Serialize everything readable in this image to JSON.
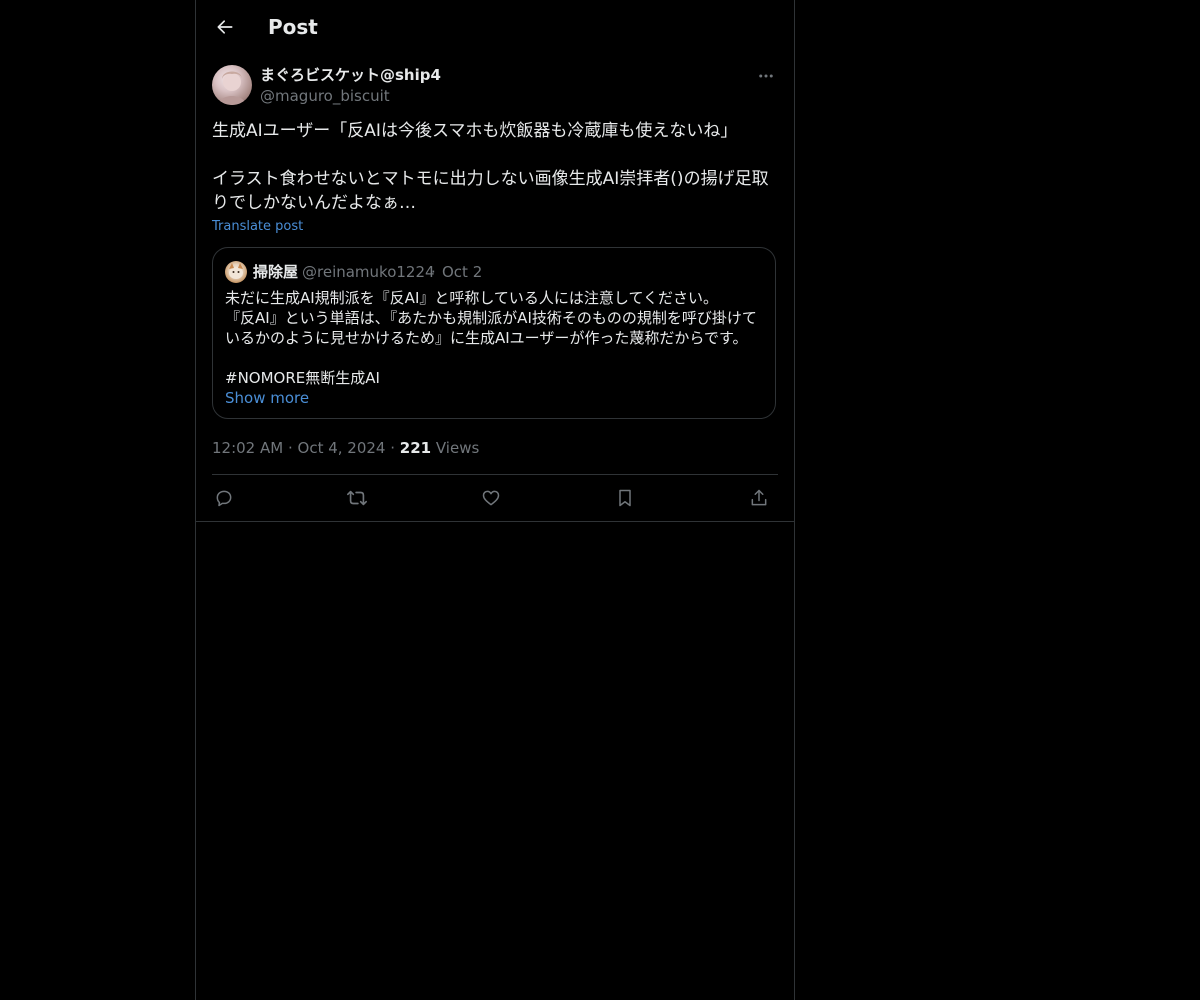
{
  "header": {
    "back_icon": "arrow-left-icon",
    "title": "Post"
  },
  "author": {
    "name": "まぐろビスケット@ship4",
    "handle": "@maguro_biscuit",
    "more_icon": "more-horizontal-icon"
  },
  "post": {
    "text": "生成AIユーザー「反AIは今後スマホも炊飯器も冷蔵庫も使えないね」\n\nイラスト食わせないとマトモに出力しない画像生成AI崇拝者()の揚げ足取りでしかないんだよなぁ…",
    "translate_label": "Translate post"
  },
  "quote": {
    "name": "掃除屋",
    "handle": "@reinamuko1224",
    "separator": "·",
    "date": "Oct 2",
    "text": "未だに生成AI規制派を『反AI』と呼称している人には注意してください。\n『反AI』という単語は、『あたかも規制派がAI技術そのものの規制を呼び掛けているかのように見せかけるため』に生成AIユーザーが作った蔑称だからです。\n\n#NOMORE無断生成AI",
    "show_more_label": "Show more"
  },
  "meta": {
    "time": "12:02 AM",
    "separator": " · ",
    "date": "Oct 4, 2024",
    "views_count": "221",
    "views_label": " Views"
  },
  "actions": {
    "reply_icon": "reply-icon",
    "repost_icon": "repost-icon",
    "like_icon": "heart-icon",
    "bookmark_icon": "bookmark-icon",
    "share_icon": "share-icon"
  },
  "colors": {
    "background": "#000000",
    "text_primary": "#e7e9ea",
    "text_secondary": "#71767b",
    "link": "#4a8ed6",
    "border": "#2f3336"
  }
}
